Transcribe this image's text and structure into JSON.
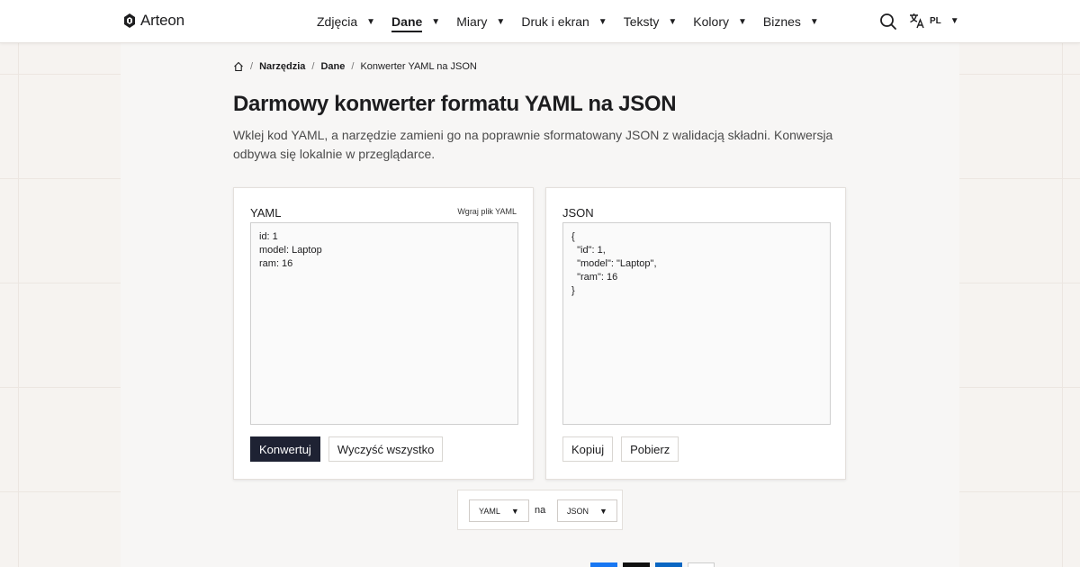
{
  "header": {
    "brand": "Arteon",
    "nav": [
      {
        "label": "Zdjęcia",
        "active": false
      },
      {
        "label": "Dane",
        "active": true
      },
      {
        "label": "Miary",
        "active": false
      },
      {
        "label": "Druk i ekran",
        "active": false
      },
      {
        "label": "Teksty",
        "active": false
      },
      {
        "label": "Kolory",
        "active": false
      },
      {
        "label": "Biznes",
        "active": false
      }
    ],
    "caret": "▼",
    "language": "PL"
  },
  "breadcrumb": {
    "sep": "/",
    "items": [
      "Narzędzia",
      "Dane"
    ],
    "current": "Konwerter YAML na JSON"
  },
  "page": {
    "title": "Darmowy konwerter formatu YAML na JSON",
    "description": "Wklej kod YAML, a narzędzie zamieni go na poprawnie sformatowany JSON z walidacją składni. Konwersja odbywa się lokalnie w przeglądarce."
  },
  "yaml_panel": {
    "label": "YAML",
    "upload": "Wgraj plik YAML",
    "content": "id: 1\nmodel: Laptop\nram: 16",
    "convert": "Konwertuj",
    "clear": "Wyczyść wszystko"
  },
  "json_panel": {
    "label": "JSON",
    "content": "{\n  \"id\": 1,\n  \"model\": \"Laptop\",\n  \"ram\": 16\n}",
    "copy": "Kopiuj",
    "download": "Pobierz"
  },
  "format": {
    "from": "YAML",
    "connector": "na",
    "to": "JSON"
  },
  "colors": {
    "primary_button": "#1e2233",
    "share_colors": [
      "#1877f2",
      "#111111",
      "#0a66c2",
      "#ffffff"
    ]
  }
}
